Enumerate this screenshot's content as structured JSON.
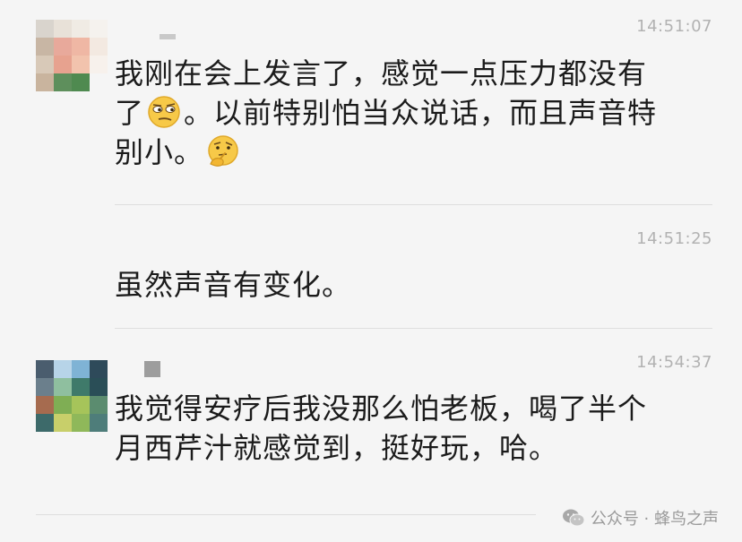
{
  "messages": [
    {
      "time": "14:51:07",
      "line1": "我刚在会上发言了，感觉一点压力都没有",
      "line2_pre": "了",
      "line2_post": "。以前特别怕当众说话，而且声音特",
      "line3": "别小。",
      "emoji_1": "smirk-emoji",
      "emoji_2": "thinking-emoji"
    },
    {
      "time": "14:51:25",
      "line1": "虽然声音有变化。"
    },
    {
      "time": "14:54:37",
      "line1": "我觉得安疗后我没那么怕老板，喝了半个",
      "line2": "月西芹汁就感觉到，挺好玩，哈。"
    }
  ],
  "watermark": {
    "text": "公众号 · 蜂鸟之声",
    "icon": "wechat-icon"
  },
  "colors": {
    "background": "#f5f5f5",
    "text": "#1b1b1b",
    "time": "#b2b2b2",
    "divider": "#dedede"
  }
}
